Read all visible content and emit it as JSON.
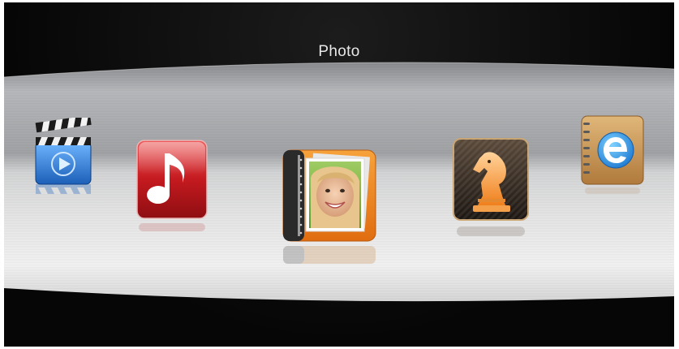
{
  "header": {
    "title": "Photo"
  },
  "menu": {
    "items": [
      {
        "name": "video",
        "icon": "clapperboard-icon",
        "selected": false
      },
      {
        "name": "music",
        "icon": "music-note-icon",
        "selected": false
      },
      {
        "name": "photo",
        "icon": "photo-album-icon",
        "selected": true
      },
      {
        "name": "game",
        "icon": "chess-knight-icon",
        "selected": false
      },
      {
        "name": "ebook",
        "icon": "ebook-notebook-icon",
        "selected": false
      }
    ]
  },
  "colors": {
    "background": "#060606",
    "band_light": "#f2f2f2",
    "band_grey": "#a9a9a9",
    "video_blue": "#2f7fd6",
    "music_red": "#c4161c",
    "photo_orange": "#f08a1c",
    "game_dark": "#2a221b",
    "ebook_tan": "#c89a5a"
  }
}
